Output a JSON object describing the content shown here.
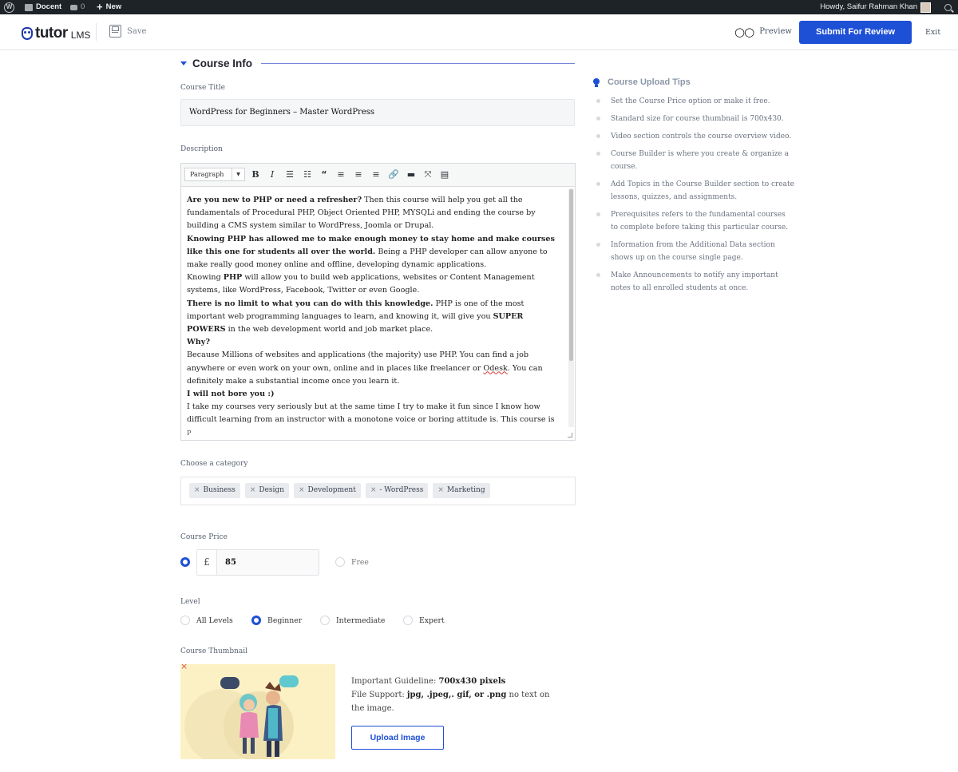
{
  "adminbar": {
    "site_name": "Docent",
    "comments_count": "0",
    "new_label": "New",
    "howdy": "Howdy, Saifur Rahman Khan"
  },
  "header": {
    "brand": "tutor",
    "brand_suffix": "LMS",
    "save_label": "Save",
    "preview_label": "Preview",
    "submit_label": "Submit For Review",
    "exit_label": "Exit"
  },
  "section": {
    "title": "Course Info"
  },
  "course_title": {
    "label": "Course Title",
    "value": "WordPress for Beginners – Master WordPress"
  },
  "description": {
    "label": "Description",
    "format_select": "Paragraph",
    "status_path": "P",
    "paragraphs": [
      {
        "bold": "Are you new to PHP or need a refresher?",
        "text": " Then this course will help you get all the fundamentals of Procedural PHP, Object Oriented PHP, MYSQLi and ending the course by building a CMS system similar to WordPress, Joomla or Drupal."
      },
      {
        "bold": "Knowing PHP has allowed me to make enough money to stay home and make courses like this one for students all over the world.",
        "text": " Being a PHP developer can allow anyone to make really good money online and offline, developing dynamic applications."
      },
      {
        "pre": "Knowing ",
        "bold": "PHP",
        "text": " will allow you to build web applications, websites or Content Management systems, like WordPress, Facebook, Twitter or even Google."
      },
      {
        "bold": "There is no limit to what you can do with this knowledge.",
        "text": " PHP is one of the most important web programming languages to learn, and knowing it, will give you ",
        "bold2": "SUPER POWERS",
        "text2": " in the web development world and job market place."
      },
      {
        "bold": "Why?",
        "text": ""
      },
      {
        "text": "Because Millions of websites and applications (the majority) use PHP. You can find a job anywhere or even work on your own, online and in places like freelancer or ",
        "misspelled": "Odesk",
        "text2": ". You can definitely make a substantial income once you learn it."
      },
      {
        "bold": "I will not bore you :)",
        "text": ""
      },
      {
        "text": "I take my courses very seriously but at the same time I try to make it fun since I know how difficult learning from an instructor with a monotone voice or boring attitude is. This course is"
      }
    ]
  },
  "category": {
    "label": "Choose a category",
    "tags": [
      "Business",
      "Design",
      "Development",
      "- WordPress",
      "Marketing"
    ]
  },
  "price": {
    "label": "Course Price",
    "currency": "£",
    "value": "85",
    "free_label": "Free"
  },
  "level": {
    "label": "Level",
    "options": [
      "All Levels",
      "Beginner",
      "Intermediate",
      "Expert"
    ],
    "selected": "Beginner"
  },
  "thumbnail": {
    "label": "Course Thumbnail",
    "remove_symbol": "×",
    "guideline_prefix": "Important Guideline: ",
    "guideline_value": "700x430 pixels",
    "support_prefix": "File Support: ",
    "support_value": "jpg, .jpeg,. gif, or .png",
    "support_suffix": " no text on the image.",
    "upload_label": "Upload Image"
  },
  "tips": {
    "title": "Course Upload Tips",
    "items": [
      "Set the Course Price option or make it free.",
      "Standard size for course thumbnail is 700x430.",
      "Video section controls the course overview video.",
      "Course Builder is where you create & organize a course.",
      "Add Topics in the Course Builder section to create lessons, quizzes, and assignments.",
      "Prerequisites refers to the fundamental courses to complete before taking this particular course.",
      "Information from the Additional Data section shows up on the course single page.",
      "Make Announcements to notify any important notes to all enrolled students at once."
    ]
  },
  "colors": {
    "accent": "#1e50d6",
    "adminbar": "#1d2327",
    "thumbnail_bg": "#fcf1c4"
  }
}
